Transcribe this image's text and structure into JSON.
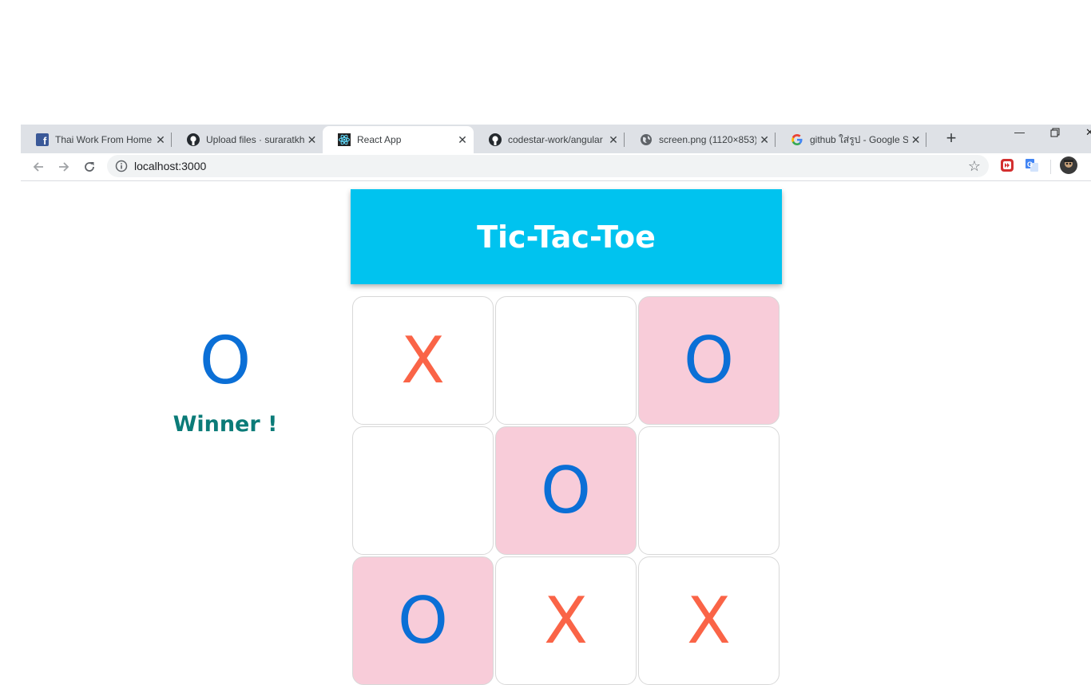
{
  "browser": {
    "tabs": [
      {
        "title": "Thai Work From Home",
        "icon": "facebook-icon",
        "active": false
      },
      {
        "title": "Upload files · suraratkha",
        "icon": "github-icon",
        "active": false
      },
      {
        "title": "React App",
        "icon": "react-icon",
        "active": true
      },
      {
        "title": "codestar-work/angular",
        "icon": "github-icon",
        "active": false
      },
      {
        "title": "screen.png (1120×853)",
        "icon": "globe-icon",
        "active": false
      },
      {
        "title": "github ใส่รูป - Google Se",
        "icon": "google-icon",
        "active": false
      }
    ],
    "new_tab": "+",
    "url": "localhost:3000"
  },
  "game": {
    "title": "Tic-Tac-Toe",
    "winner_symbol": "O",
    "winner_label": "Winner !",
    "board": [
      {
        "value": "X",
        "highlight": false
      },
      {
        "value": "",
        "highlight": false
      },
      {
        "value": "O",
        "highlight": true
      },
      {
        "value": "",
        "highlight": false
      },
      {
        "value": "O",
        "highlight": true
      },
      {
        "value": "",
        "highlight": false
      },
      {
        "value": "O",
        "highlight": true
      },
      {
        "value": "X",
        "highlight": false
      },
      {
        "value": "X",
        "highlight": false
      }
    ]
  },
  "colors": {
    "header_bg": "#00c3ef",
    "x_mark": "#fa6447",
    "o_mark": "#0b6fd6",
    "winning_cell": "#f8ccd9",
    "winner_text": "#0b7b78"
  }
}
